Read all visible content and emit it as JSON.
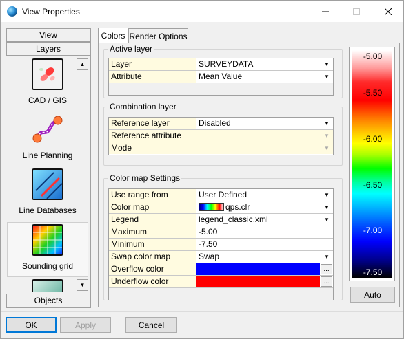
{
  "window": {
    "title": "View Properties",
    "minimize": "—",
    "maximize": "☐",
    "close": "✕"
  },
  "left_panel": {
    "header_view": "View",
    "header_layers": "Layers",
    "footer_objects": "Objects",
    "items": [
      {
        "label": "CAD / GIS",
        "icon": "cad-gis-icon"
      },
      {
        "label": "Line Planning",
        "icon": "line-planning-icon"
      },
      {
        "label": "Line Databases",
        "icon": "line-databases-icon"
      },
      {
        "label": "Sounding grid",
        "icon": "sounding-grid-icon",
        "selected": true
      },
      {
        "label": "",
        "icon": "partial-layer-icon"
      }
    ],
    "scroll_up": "▲",
    "scroll_down": "▼"
  },
  "tabs": [
    {
      "label": "Colors",
      "active": true
    },
    {
      "label": "Render Options",
      "active": false
    }
  ],
  "active_layer": {
    "title": "Active layer",
    "rows": [
      {
        "label": "Layer",
        "value": "SURVEYDATA"
      },
      {
        "label": "Attribute",
        "value": "Mean Value"
      }
    ]
  },
  "combination_layer": {
    "title": "Combination layer",
    "rows": [
      {
        "label": "Reference layer",
        "value": "Disabled"
      },
      {
        "label": "Reference attribute",
        "value": ""
      },
      {
        "label": "Mode",
        "value": ""
      }
    ]
  },
  "color_map_settings": {
    "title": "Color map Settings",
    "rows": [
      {
        "label": "Use range from",
        "value": "User Defined"
      },
      {
        "label": "Color map",
        "value": "qps.clr"
      },
      {
        "label": "Legend",
        "value": "legend_classic.xml"
      },
      {
        "label": "Maximum",
        "value": "-5.00"
      },
      {
        "label": "Minimum",
        "value": "-7.50"
      },
      {
        "label": "Swap color map",
        "value": "Swap"
      },
      {
        "label": "Overflow color",
        "value": "",
        "color": "#0000ff"
      },
      {
        "label": "Underflow color",
        "value": "",
        "color": "#ff0000"
      }
    ],
    "ellipsis": "..."
  },
  "color_bar": {
    "ticks": [
      "-5.00",
      "-5.50",
      "-6.00",
      "-6.50",
      "-7.00",
      "-7.50"
    ],
    "auto_label": "Auto"
  },
  "footer": {
    "ok": "OK",
    "apply": "Apply",
    "cancel": "Cancel"
  }
}
